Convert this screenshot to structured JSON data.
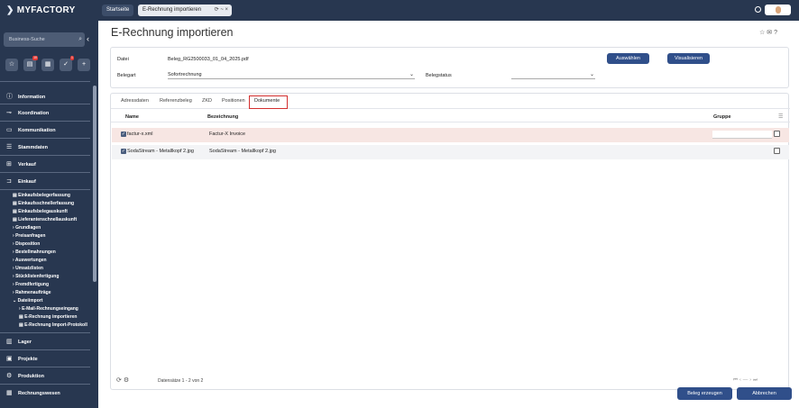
{
  "app": {
    "logo": "MYFACTORY",
    "tabs": [
      {
        "label": "Startseite"
      },
      {
        "label": "E-Rechnung importieren",
        "controls": "⟳ ~ ×"
      }
    ]
  },
  "sidebar": {
    "search_placeholder": "Business-Suche",
    "quick_badges": [
      "10",
      "1"
    ],
    "sections": [
      {
        "label": "Information",
        "icon": "info-icon"
      },
      {
        "label": "Koordination",
        "icon": "coordination-icon"
      },
      {
        "label": "Kommunikation",
        "icon": "chat-icon"
      },
      {
        "label": "Stammdaten",
        "icon": "database-icon"
      },
      {
        "label": "Verkauf",
        "icon": "sales-icon"
      },
      {
        "label": "Einkauf",
        "icon": "cart-icon"
      }
    ],
    "einkauf_items": [
      "Einkaufsbelegerfassung",
      "Einkaufsschnellerfassung",
      "Einkaufsbelegauskunft",
      "Lieferantenschnellauskunft",
      "Grundlagen",
      "Preisanfragen",
      "Disposition",
      "Bestellmahnungen",
      "Auswertungen",
      "Umsatzlisten",
      "Stücklistenfertigung",
      "Fremdfertigung",
      "Rahmenaufträge",
      "Dateiimport"
    ],
    "dateiimport_items": [
      "E-Mail-Rechnungseingang",
      "E-Rechnung importieren",
      "E-Rechnung Import-Protokoll"
    ],
    "lower_sections": [
      {
        "label": "Lager",
        "icon": "warehouse-icon"
      },
      {
        "label": "Projekte",
        "icon": "projects-icon"
      },
      {
        "label": "Produktion",
        "icon": "production-icon"
      },
      {
        "label": "Rechnungswesen",
        "icon": "accounting-icon"
      }
    ]
  },
  "page": {
    "title": "E-Rechnung importieren",
    "form": {
      "datei_label": "Datei",
      "datei_value": "Beleg_RG2500033_01_04_2025.pdf",
      "belegart_label": "Belegart",
      "belegart_value": "Sofortrechnung",
      "belegstatus_label": "Belegstatus",
      "belegstatus_value": "",
      "auswaehlen_label": "Auswählen",
      "visualisieren_label": "Visualisieren"
    },
    "detail_tabs": [
      "Adressdaten",
      "Referenzbeleg",
      "ZKD",
      "Positionen",
      "Dokumente"
    ],
    "table": {
      "headers": [
        "Name",
        "Bezeichnung",
        "Gruppe"
      ],
      "rows": [
        {
          "name": "factur-x.xml",
          "bezeichnung": "Factur-X Invoice",
          "gruppe": ""
        },
        {
          "name": "SodaStream - Metallkopf 2.jpg",
          "bezeichnung": "SodaStream - Metallkopf 2.jpg",
          "gruppe": ""
        }
      ],
      "footer": "Datensätze 1 - 2 von 2"
    },
    "buttons": {
      "beleg_erzeugen": "Beleg erzeugen",
      "abbrechen": "Abbrechen"
    }
  },
  "colors": {
    "topbar": "#283750",
    "accent_button": "#304f8a",
    "highlight_row": "#f7e6e3",
    "highlight_border": "#d32f2f"
  }
}
